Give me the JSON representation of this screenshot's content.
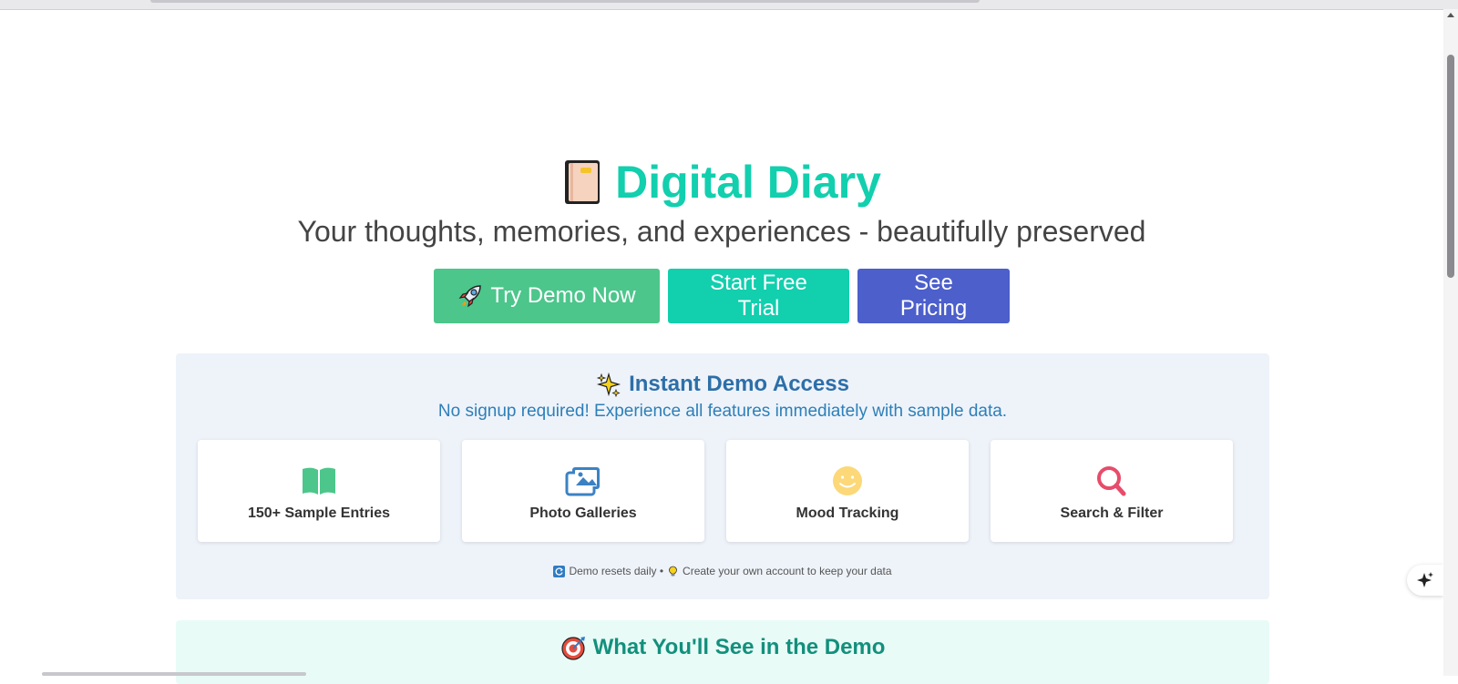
{
  "hero": {
    "title": "Digital Diary",
    "subtitle": "Your thoughts, memories, and experiences - beautifully preserved"
  },
  "cta": {
    "demo_label": "Try Demo Now",
    "trial_label": "Start Free Trial",
    "pricing_label": "See Pricing"
  },
  "demo": {
    "heading": "Instant Demo Access",
    "subheading": "No signup required! Experience all features immediately with sample data.",
    "cards": [
      {
        "label": "150+ Sample Entries",
        "icon": "book-open-icon"
      },
      {
        "label": "Photo Galleries",
        "icon": "images-icon"
      },
      {
        "label": "Mood Tracking",
        "icon": "smile-icon"
      },
      {
        "label": "Search & Filter",
        "icon": "search-icon"
      }
    ],
    "note_part1": "Demo resets daily •",
    "note_part2": "Create your own account to keep your data"
  },
  "next_section": {
    "heading": "What You'll See in the Demo"
  },
  "colors": {
    "brand_teal": "#12cfae",
    "demo_green": "#4cc68b",
    "pricing_blue": "#4c5fcb",
    "demo_heading": "#2d6fa8",
    "card_book": "#4cc68b",
    "card_photos": "#3b82c4",
    "card_mood": "#fcd878",
    "card_search": "#e74c6b"
  }
}
